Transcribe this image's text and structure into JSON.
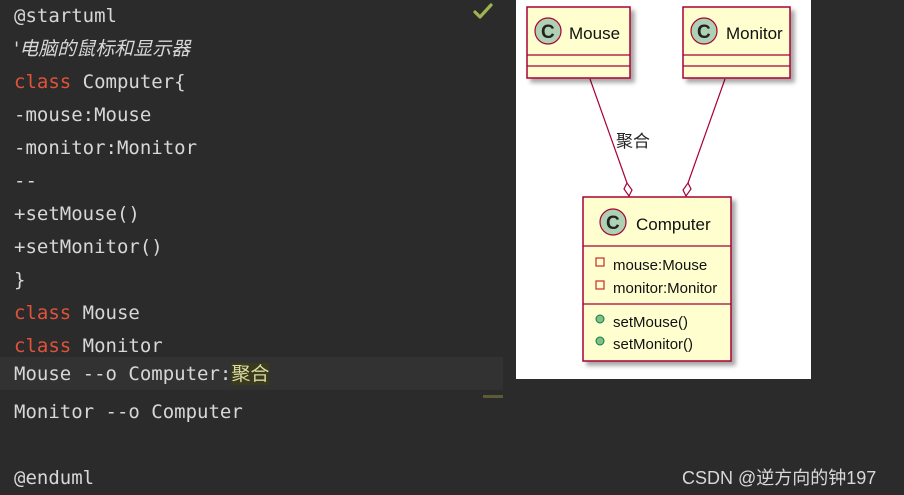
{
  "editor": {
    "lines": [
      {
        "kind": "ann",
        "text": "@startuml"
      },
      {
        "kind": "cmt",
        "text": "'电脑的鼠标和显示器"
      },
      {
        "kind": "kw",
        "kw": "class",
        "rest": " Computer{"
      },
      {
        "kind": "plain",
        "text": "-mouse:Mouse"
      },
      {
        "kind": "plain",
        "text": "-monitor:Monitor"
      },
      {
        "kind": "plain",
        "text": "--"
      },
      {
        "kind": "plain",
        "text": "+setMouse()"
      },
      {
        "kind": "plain",
        "text": "+setMonitor()"
      },
      {
        "kind": "plain",
        "text": "}"
      },
      {
        "kind": "kw",
        "kw": "class",
        "rest": " Mouse"
      },
      {
        "kind": "kw",
        "kw": "class",
        "rest": " Monitor"
      },
      {
        "kind": "rel",
        "text": "Mouse --o Computer:",
        "label": "聚合"
      },
      {
        "kind": "plain",
        "text": "Monitor --o Computer"
      },
      {
        "kind": "plain",
        "text": ""
      },
      {
        "kind": "ann",
        "text": "@enduml"
      }
    ]
  },
  "diagram": {
    "classes": [
      {
        "name": "Mouse",
        "letter": "C"
      },
      {
        "name": "Monitor",
        "letter": "C"
      },
      {
        "name": "Computer",
        "letter": "C",
        "members": [
          {
            "vis": "private",
            "text": "mouse:Mouse"
          },
          {
            "vis": "private",
            "text": "monitor:Monitor"
          },
          {
            "vis": "public",
            "text": "setMouse()"
          },
          {
            "vis": "public",
            "text": "setMonitor()"
          }
        ]
      }
    ],
    "relation_label": "聚合"
  },
  "watermark": "CSDN @逆方向的钟197",
  "colors": {
    "editor_bg": "#2b2b2b",
    "keyword": "#e0533a",
    "annotation": "#a7b063",
    "class_fill": "#fefece",
    "class_border": "#a80036",
    "circle_fill": "#add1b2"
  }
}
